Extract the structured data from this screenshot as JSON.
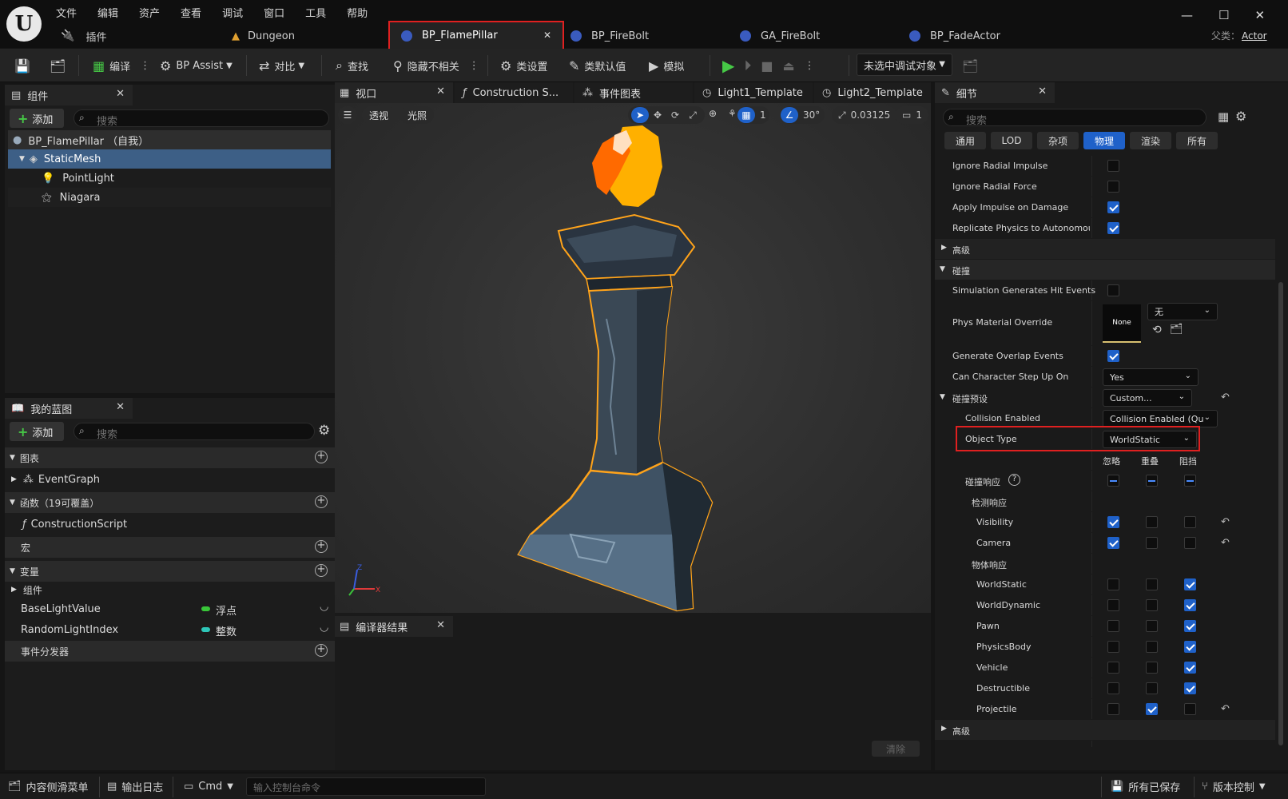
{
  "menu": [
    "文件",
    "编辑",
    "资产",
    "查看",
    "调试",
    "窗口",
    "工具",
    "帮助"
  ],
  "doc_tabs": {
    "plugins": "插件",
    "dungeon": "Dungeon",
    "active": "BP_FlamePillar",
    "t3": "BP_FireBolt",
    "t4": "GA_FireBolt",
    "t5": "BP_FadeActor"
  },
  "parent": {
    "label": "父类：",
    "value": "Actor"
  },
  "toolbar": {
    "compile": "编译",
    "bp_assist": "BP Assist",
    "diff": "对比",
    "find": "查找",
    "hide_unrelated": "隐藏不相关",
    "class_settings": "类设置",
    "class_defaults": "类默认值",
    "simulate": "模拟",
    "debug_target": "未选中调试对象"
  },
  "components": {
    "tab": "组件",
    "add": "添加",
    "search_placeholder": "搜索",
    "root": "BP_FlamePillar （自我）",
    "items": [
      "StaticMesh",
      "PointLight",
      "Niagara"
    ]
  },
  "my_blueprint": {
    "tab": "我的蓝图",
    "add": "添加",
    "search_placeholder": "搜索",
    "graphs": "图表",
    "event_graph": "EventGraph",
    "functions": "函数（19可覆盖）",
    "construction_script": "ConstructionScript",
    "macros": "宏",
    "variables": "变量",
    "components": "组件",
    "vars": [
      {
        "name": "BaseLightValue",
        "type": "浮点",
        "color": "#39c639"
      },
      {
        "name": "RandomLightIndex",
        "type": "整数",
        "color": "#2ec6b8"
      }
    ],
    "dispatchers": "事件分发器"
  },
  "editor_tabs": {
    "viewport": "视口",
    "construction": "Construction S...",
    "event_graph": "事件图表",
    "light1": "Light1_Template",
    "light2": "Light2_Template"
  },
  "viewport": {
    "perspective": "透视",
    "lit": "光照",
    "grid_value": "1",
    "angle_value": "30°",
    "scale_value": "0.03125",
    "camera_speed": "1"
  },
  "compiler": {
    "tab": "编译器结果",
    "clear": "清除"
  },
  "details": {
    "tab": "细节",
    "search_placeholder": "搜索",
    "filters": [
      "通用",
      "LOD",
      "杂项",
      "物理",
      "渲染",
      "所有"
    ],
    "active_filter": "物理",
    "physics_rows": [
      {
        "label": "Ignore Radial Impulse",
        "checked": false
      },
      {
        "label": "Ignore Radial Force",
        "checked": false
      },
      {
        "label": "Apply Impulse on Damage",
        "checked": true
      },
      {
        "label": "Replicate Physics to Autonomous...",
        "checked": true
      }
    ],
    "advanced": "高级",
    "collision": "碰撞",
    "sim_hit_events": "Simulation Generates Hit Events",
    "phys_material": "Phys Material Override",
    "phys_material_thumb": "None",
    "phys_material_value": "无",
    "overlap_events": "Generate Overlap Events",
    "step_up": "Can Character Step Up On",
    "step_up_value": "Yes",
    "presets": "碰撞预设",
    "presets_value": "Custom...",
    "collision_enabled": "Collision Enabled",
    "collision_enabled_value": "Collision Enabled (Que",
    "object_type": "Object Type",
    "object_type_value": "WorldStatic",
    "col_headers": [
      "忽略",
      "重叠",
      "阻挡"
    ],
    "responses": "碰撞响应",
    "trace_responses": "检测响应",
    "object_responses": "物体响应",
    "trace_rows": [
      {
        "label": "Visibility",
        "state": [
          1,
          0,
          0
        ]
      },
      {
        "label": "Camera",
        "state": [
          1,
          0,
          0
        ]
      }
    ],
    "object_rows": [
      {
        "label": "WorldStatic",
        "state": [
          0,
          0,
          1
        ]
      },
      {
        "label": "WorldDynamic",
        "state": [
          0,
          0,
          1
        ]
      },
      {
        "label": "Pawn",
        "state": [
          0,
          0,
          1
        ]
      },
      {
        "label": "PhysicsBody",
        "state": [
          0,
          0,
          1
        ]
      },
      {
        "label": "Vehicle",
        "state": [
          0,
          0,
          1
        ]
      },
      {
        "label": "Destructible",
        "state": [
          0,
          0,
          1
        ]
      },
      {
        "label": "Projectile",
        "state": [
          0,
          1,
          0
        ]
      }
    ],
    "advanced2": "高级"
  },
  "statusbar": {
    "content_drawer": "内容侧滑菜单",
    "output_log": "输出日志",
    "cmd": "Cmd",
    "console_placeholder": "输入控制台命令",
    "saved": "所有已保存",
    "source_control": "版本控制"
  },
  "colors": {
    "accent": "#1f61c9",
    "highlight": "#e02020",
    "selection": "#3d5f86",
    "flame": "#ffb000",
    "outline": "#ffa31a"
  }
}
